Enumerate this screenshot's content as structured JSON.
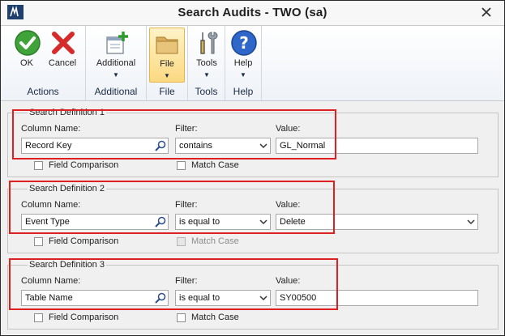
{
  "window": {
    "title": "Search Audits  -  TWO (sa)"
  },
  "ribbon": {
    "groups": [
      {
        "label": "Actions",
        "buttons": [
          {
            "label": "OK",
            "icon": "check-icon"
          },
          {
            "label": "Cancel",
            "icon": "x-icon"
          }
        ]
      },
      {
        "label": "Additional",
        "buttons": [
          {
            "label": "Additional",
            "icon": "add-window-icon"
          }
        ]
      },
      {
        "label": "File",
        "buttons": [
          {
            "label": "File",
            "icon": "folder-icon"
          }
        ]
      },
      {
        "label": "Tools",
        "buttons": [
          {
            "label": "Tools",
            "icon": "tools-icon"
          }
        ]
      },
      {
        "label": "Help",
        "buttons": [
          {
            "label": "Help",
            "icon": "help-icon"
          }
        ]
      }
    ]
  },
  "labels": {
    "column_name": "Column Name:",
    "filter": "Filter:",
    "value": "Value:",
    "field_comparison": "Field Comparison",
    "match_case": "Match Case"
  },
  "definitions": [
    {
      "title": "Search Definition 1",
      "column_name": "Record Key",
      "filter": "contains",
      "value": "GL_Normal",
      "field_comparison": false,
      "match_case": false,
      "match_case_enabled": true,
      "value_is_dropdown": false
    },
    {
      "title": "Search Definition 2",
      "column_name": "Event Type",
      "filter": "is equal to",
      "value": "Delete",
      "field_comparison": false,
      "match_case": false,
      "match_case_enabled": false,
      "value_is_dropdown": true
    },
    {
      "title": "Search Definition 3",
      "column_name": "Table Name",
      "filter": "is equal to",
      "value": "SY00500",
      "field_comparison": false,
      "match_case": false,
      "match_case_enabled": true,
      "value_is_dropdown": false
    }
  ],
  "colors": {
    "highlight": "#e02020",
    "ribbon_text": "#1b2a44",
    "active_button": "#fbd981"
  }
}
